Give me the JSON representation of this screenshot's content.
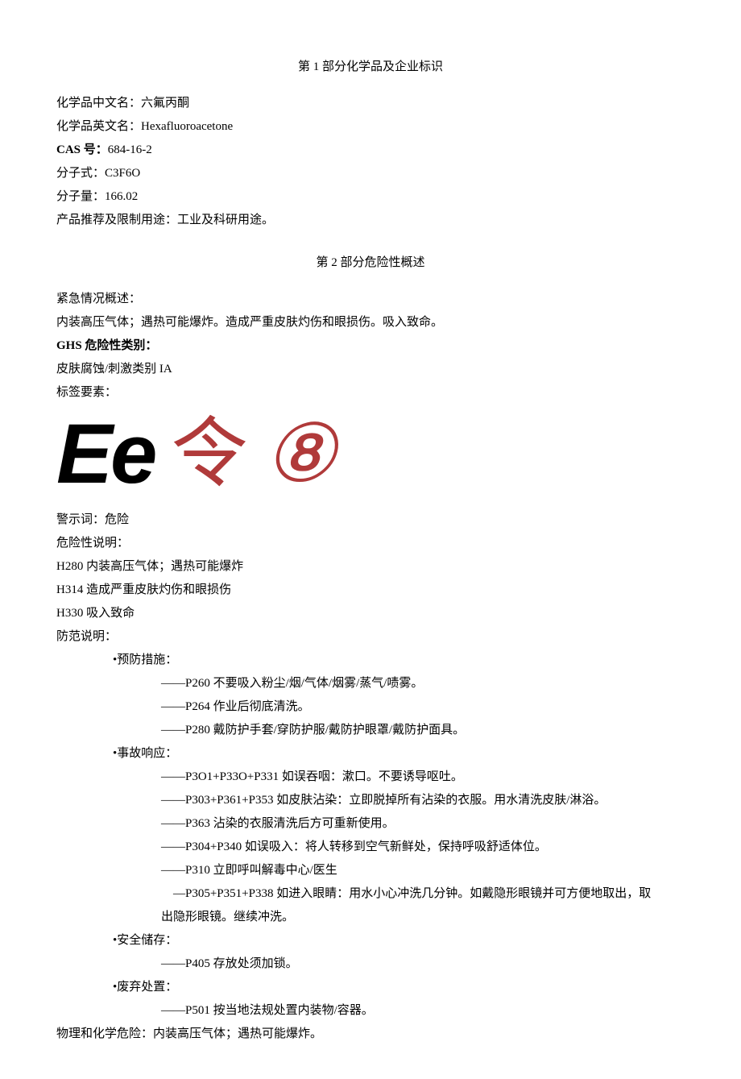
{
  "section1": {
    "title": "第 1 部分化学品及企业标识",
    "cn_name_label": "化学品中文名：",
    "cn_name_value": "六氟丙酮",
    "en_name_label": "化学品英文名：",
    "en_name_value": "Hexafluoroacetone",
    "cas_label": "CAS 号：",
    "cas_value": "684-16-2",
    "formula_label": "分子式：",
    "formula_value": "C3F6O",
    "mw_label": "分子量：",
    "mw_value": "166.02",
    "use_label": "产品推荐及限制用途：",
    "use_value": "工业及科研用途。"
  },
  "section2": {
    "title": "第 2 部分危险性概述",
    "emergency_label": "紧急情况概述：",
    "emergency_value": "内装高压气体；遇热可能爆炸。造成严重皮肤灼伤和眼损伤。吸入致命。",
    "ghs_label": "GHS 危险性类别：",
    "ghs_skin": "皮肤腐蚀/刺激类别 IA",
    "label_elements": "标签要素：",
    "pictogram_ee": "Ee",
    "pictogram_ling": "令",
    "pictogram_8": "⑧",
    "signal_label": "警示词：",
    "signal_value": "危险",
    "hazard_label": "危险性说明：",
    "h280": "H280 内装高压气体；遇热可能爆炸",
    "h314": "H314 造成严重皮肤灼伤和眼损伤",
    "h330": "H330 吸入致命",
    "precaution_label": "防范说明：",
    "prevention_title": "•预防措施：",
    "p260": "——P260 不要吸入粉尘/烟/气体/烟雾/蒸气/啧雾。",
    "p264": "——P264 作业后彻底清洗。",
    "p280": "——P280 戴防护手套/穿防护服/戴防护眼罩/戴防护面具。",
    "response_title": "•事故响应：",
    "p301": "——P3O1+P33O+P331 如误吞咽：漱口。不要诱导呕吐。",
    "p303": "——P303+P361+P353 如皮肤沾染：立即脱掉所有沾染的衣服。用水清洗皮肤/淋浴。",
    "p363": "——P363 沾染的衣服清洗后方可重新使用。",
    "p304": "——P304+P340 如误吸入：将人转移到空气新鲜处，保持呼吸舒适体位。",
    "p310": "——P310 立即呼叫解毒中心/医生",
    "p305a": "—P305+P351+P338 如进入眼睛：用水小心冲洗几分钟。如戴隐形眼镜并可方便地取出，取",
    "p305b": "出隐形眼镜。继续冲洗。",
    "storage_title": "•安全储存：",
    "p405": "——P405 存放处须加锁。",
    "disposal_title": "•废弃处置：",
    "p501": "——P501 按当地法规处置内装物/容器。",
    "phys_label": "物理和化学危险：",
    "phys_value": "内装高压气体；遇热可能爆炸。"
  }
}
